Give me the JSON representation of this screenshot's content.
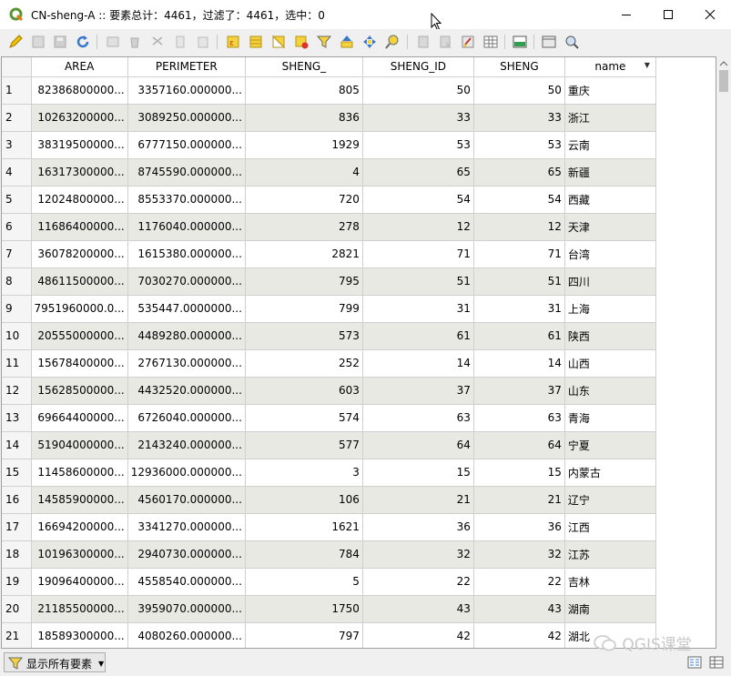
{
  "window": {
    "title": "CN-sheng-A :: 要素总计：4461，过滤了：4461，选中：0",
    "minimize_icon": "minimize-icon",
    "maximize_icon": "maximize-icon",
    "close_icon": "close-icon"
  },
  "toolbar": {
    "icons": [
      "toggle-editing-icon",
      "multi-edit-icon",
      "save-edits-icon",
      "reload-icon",
      "add-feature-icon",
      "delete-feature-icon",
      "cut-icon",
      "copy-icon",
      "paste-icon",
      "select-by-expression-icon",
      "select-all-icon",
      "invert-selection-icon",
      "deselect-all-icon",
      "filter-select-icon",
      "move-selection-top-icon",
      "pan-to-selected-icon",
      "zoom-to-selected-icon",
      "new-field-icon",
      "delete-field-icon",
      "field-calculator-icon",
      "conditional-formatting-icon",
      "dock-table-icon",
      "actions-icon",
      "zoom-map-icon"
    ]
  },
  "table": {
    "columns": [
      "AREA",
      "PERIMETER",
      "SHENG_",
      "SHENG_ID",
      "SHENG",
      "name"
    ],
    "rows": [
      [
        "1",
        "82386800000...",
        "3357160.000000...",
        "805",
        "50",
        "50",
        "重庆"
      ],
      [
        "2",
        "10263200000...",
        "3089250.000000...",
        "836",
        "33",
        "33",
        "浙江"
      ],
      [
        "3",
        "38319500000...",
        "6777150.000000...",
        "1929",
        "53",
        "53",
        "云南"
      ],
      [
        "4",
        "16317300000...",
        "8745590.000000...",
        "4",
        "65",
        "65",
        "新疆"
      ],
      [
        "5",
        "12024800000...",
        "8553370.000000...",
        "720",
        "54",
        "54",
        "西藏"
      ],
      [
        "6",
        "11686400000...",
        "1176040.000000...",
        "278",
        "12",
        "12",
        "天津"
      ],
      [
        "7",
        "36078200000...",
        "1615380.000000...",
        "2821",
        "71",
        "71",
        "台湾"
      ],
      [
        "8",
        "48611500000...",
        "7030270.000000...",
        "795",
        "51",
        "51",
        "四川"
      ],
      [
        "9",
        "7951960000.0...",
        "535447.0000000...",
        "799",
        "31",
        "31",
        "上海"
      ],
      [
        "10",
        "20555000000...",
        "4489280.000000...",
        "573",
        "61",
        "61",
        "陕西"
      ],
      [
        "11",
        "15678400000...",
        "2767130.000000...",
        "252",
        "14",
        "14",
        "山西"
      ],
      [
        "12",
        "15628500000...",
        "4432520.000000...",
        "603",
        "37",
        "37",
        "山东"
      ],
      [
        "13",
        "69664400000...",
        "6726040.000000...",
        "574",
        "63",
        "63",
        "青海"
      ],
      [
        "14",
        "51904000000...",
        "2143240.000000...",
        "577",
        "64",
        "64",
        "宁夏"
      ],
      [
        "15",
        "11458600000...",
        "12936000.000000...",
        "3",
        "15",
        "15",
        "内蒙古"
      ],
      [
        "16",
        "14585900000...",
        "4560170.000000...",
        "106",
        "21",
        "21",
        "辽宁"
      ],
      [
        "17",
        "16694200000...",
        "3341270.000000...",
        "1621",
        "36",
        "36",
        "江西"
      ],
      [
        "18",
        "10196300000...",
        "2940730.000000...",
        "784",
        "32",
        "32",
        "江苏"
      ],
      [
        "19",
        "19096400000...",
        "4558540.000000...",
        "5",
        "22",
        "22",
        "吉林"
      ],
      [
        "20",
        "21185500000...",
        "3959070.000000...",
        "1750",
        "43",
        "43",
        "湖南"
      ],
      [
        "21",
        "18589300000...",
        "4080260.000000...",
        "797",
        "42",
        "42",
        "湖北"
      ]
    ]
  },
  "bottom": {
    "filter_label": "显示所有要素",
    "watermark": "QGIS课堂"
  }
}
